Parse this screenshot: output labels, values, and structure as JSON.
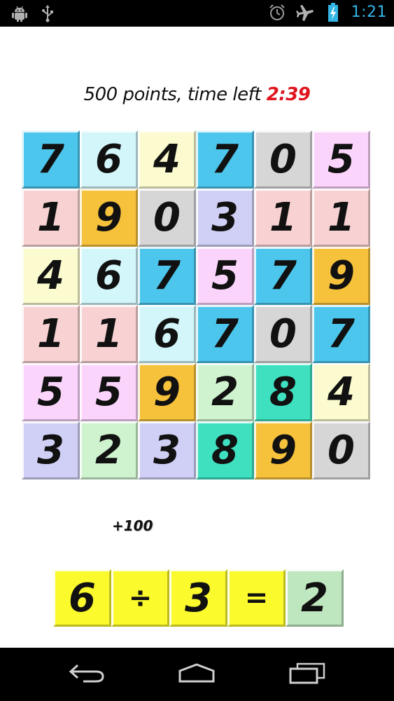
{
  "status_bar": {
    "time": "1:21",
    "left_icons": [
      "android-debug-icon",
      "usb-icon"
    ],
    "right_icons": [
      "alarm-icon",
      "airplane-mode-icon",
      "battery-charging-icon"
    ]
  },
  "header": {
    "score_prefix": "500 points, time left ",
    "time_left": "2:39"
  },
  "grid": {
    "rows": [
      [
        "7",
        "6",
        "4",
        "7",
        "0",
        "5"
      ],
      [
        "1",
        "9",
        "0",
        "3",
        "1",
        "1"
      ],
      [
        "4",
        "6",
        "7",
        "5",
        "7",
        "9"
      ],
      [
        "1",
        "1",
        "6",
        "7",
        "0",
        "7"
      ],
      [
        "5",
        "5",
        "9",
        "2",
        "8",
        "4"
      ],
      [
        "3",
        "2",
        "3",
        "8",
        "9",
        "0"
      ]
    ],
    "colors": [
      [
        "#4cc6ec",
        "#d2f6fa",
        "#fbfbcf",
        "#4cc6ec",
        "#d6d6d6",
        "#fbd4fb"
      ],
      [
        "#f8d2d2",
        "#f6c23c",
        "#d6d6d6",
        "#d0d0f6",
        "#f8d2d2",
        "#f8d2d2"
      ],
      [
        "#fbfbcf",
        "#d2f6fa",
        "#4cc6ec",
        "#fbd4fb",
        "#4cc6ec",
        "#f6c23c"
      ],
      [
        "#f8d2d2",
        "#f8d2d2",
        "#d2f6fa",
        "#4cc6ec",
        "#d6d6d6",
        "#4cc6ec"
      ],
      [
        "#fbd4fb",
        "#fbd4fb",
        "#f6c23c",
        "#cff2cf",
        "#3ee0c0",
        "#fbfbcf"
      ],
      [
        "#d0d0f6",
        "#cff2cf",
        "#d0d0f6",
        "#3ee0c0",
        "#f6c23c",
        "#d6d6d6"
      ]
    ]
  },
  "bonus": "+100",
  "equation": {
    "tiles": [
      "6",
      "÷",
      "3",
      "=",
      "2"
    ],
    "colors": [
      "#fafa2c",
      "#fafa2c",
      "#fafa2c",
      "#fafa2c",
      "#bfe7bf"
    ]
  },
  "nav_bar": {
    "buttons": [
      "back-icon",
      "home-icon",
      "recent-apps-icon"
    ]
  }
}
